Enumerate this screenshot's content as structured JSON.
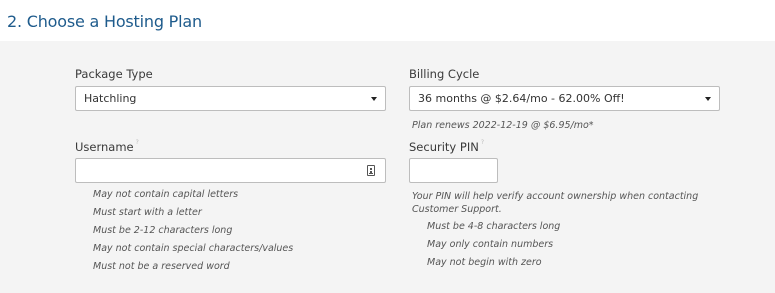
{
  "section": {
    "title": "2. Choose a Hosting Plan"
  },
  "package": {
    "label": "Package Type",
    "selected": "Hatchling"
  },
  "billing": {
    "label": "Billing Cycle",
    "selected": "36 months @ $2.64/mo - 62.00% Off!",
    "renew_note": "Plan renews 2022-12-19 @ $6.95/mo*"
  },
  "username": {
    "label": "Username",
    "marker": "?",
    "value": "",
    "rules": [
      "May not contain capital letters",
      "Must start with a letter",
      "Must be 2-12 characters long",
      "May not contain special characters/values",
      "Must not be a reserved word"
    ]
  },
  "pin": {
    "label": "Security PIN",
    "marker": "?",
    "value": "",
    "description": "Your PIN will help verify account ownership when contacting Customer Support.",
    "rules": [
      "Must be 4-8 characters long",
      "May only contain numbers",
      "May not begin with zero"
    ]
  },
  "icons": {
    "select_caret": "chevron-down-icon",
    "username_field_icon": "keyboard-icon"
  },
  "colors": {
    "title": "#1e5b8c",
    "background": "#f4f4f4",
    "field_border": "#bdbdbd"
  }
}
